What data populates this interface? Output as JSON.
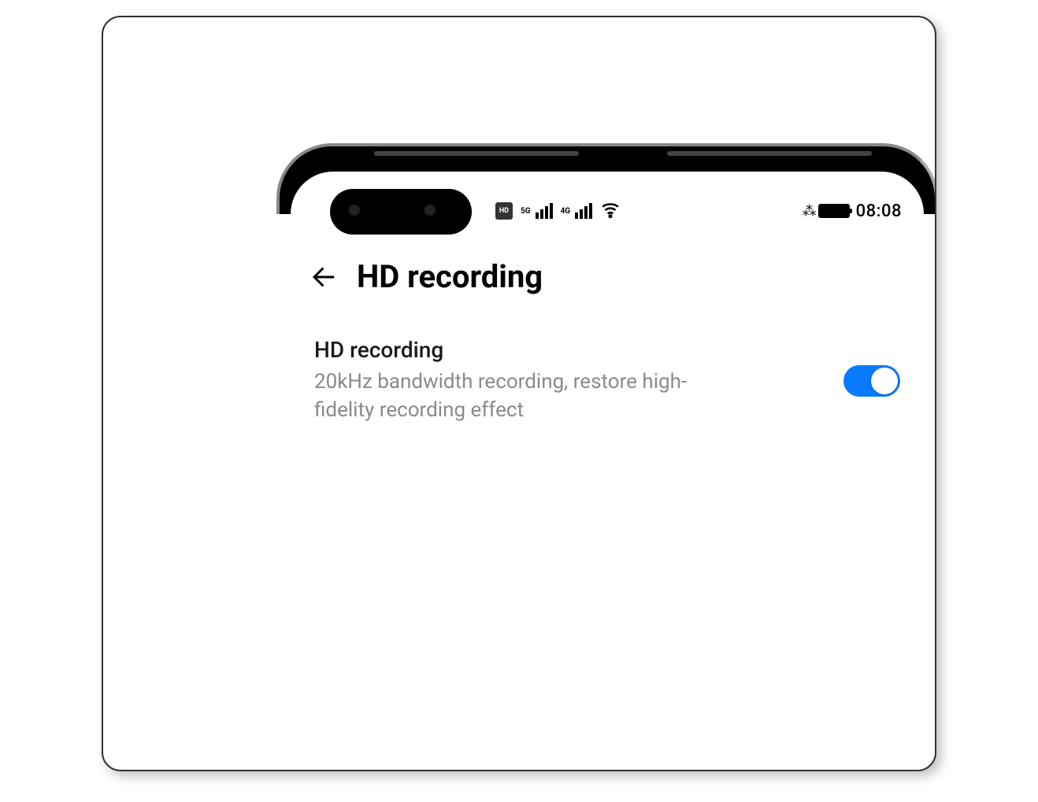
{
  "status_bar": {
    "hd_badge": "HD",
    "network_type_1": "5G",
    "network_type_2": "4G",
    "time": "08:08"
  },
  "header": {
    "title": "HD recording"
  },
  "setting": {
    "title": "HD recording",
    "description": "20kHz bandwidth recording, restore high-fidelity recording effect",
    "enabled": true
  }
}
